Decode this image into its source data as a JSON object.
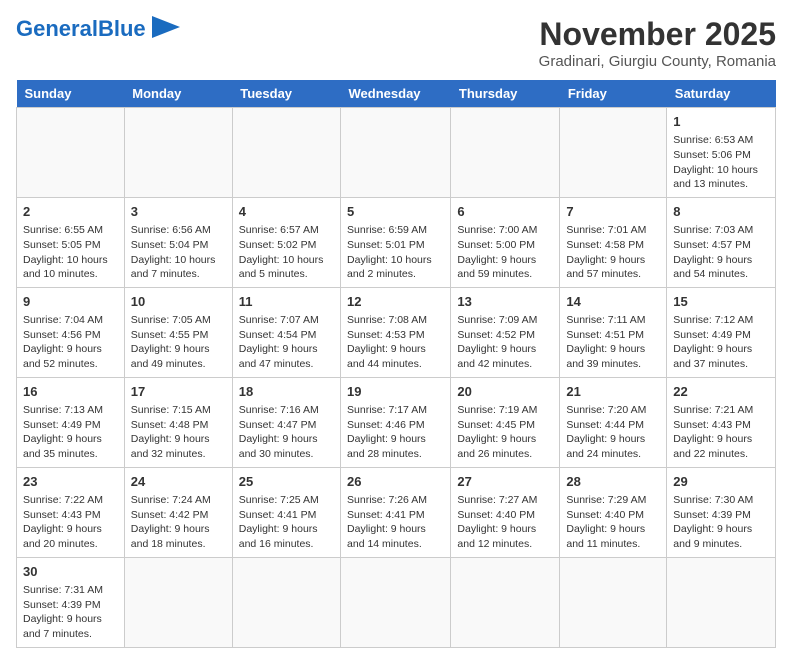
{
  "header": {
    "logo_general": "General",
    "logo_blue": "Blue",
    "month_title": "November 2025",
    "location": "Gradinari, Giurgiu County, Romania"
  },
  "weekdays": [
    "Sunday",
    "Monday",
    "Tuesday",
    "Wednesday",
    "Thursday",
    "Friday",
    "Saturday"
  ],
  "weeks": [
    [
      {
        "day": "",
        "info": ""
      },
      {
        "day": "",
        "info": ""
      },
      {
        "day": "",
        "info": ""
      },
      {
        "day": "",
        "info": ""
      },
      {
        "day": "",
        "info": ""
      },
      {
        "day": "",
        "info": ""
      },
      {
        "day": "1",
        "info": "Sunrise: 6:53 AM\nSunset: 5:06 PM\nDaylight: 10 hours\nand 13 minutes."
      }
    ],
    [
      {
        "day": "2",
        "info": "Sunrise: 6:55 AM\nSunset: 5:05 PM\nDaylight: 10 hours\nand 10 minutes."
      },
      {
        "day": "3",
        "info": "Sunrise: 6:56 AM\nSunset: 5:04 PM\nDaylight: 10 hours\nand 7 minutes."
      },
      {
        "day": "4",
        "info": "Sunrise: 6:57 AM\nSunset: 5:02 PM\nDaylight: 10 hours\nand 5 minutes."
      },
      {
        "day": "5",
        "info": "Sunrise: 6:59 AM\nSunset: 5:01 PM\nDaylight: 10 hours\nand 2 minutes."
      },
      {
        "day": "6",
        "info": "Sunrise: 7:00 AM\nSunset: 5:00 PM\nDaylight: 9 hours\nand 59 minutes."
      },
      {
        "day": "7",
        "info": "Sunrise: 7:01 AM\nSunset: 4:58 PM\nDaylight: 9 hours\nand 57 minutes."
      },
      {
        "day": "8",
        "info": "Sunrise: 7:03 AM\nSunset: 4:57 PM\nDaylight: 9 hours\nand 54 minutes."
      }
    ],
    [
      {
        "day": "9",
        "info": "Sunrise: 7:04 AM\nSunset: 4:56 PM\nDaylight: 9 hours\nand 52 minutes."
      },
      {
        "day": "10",
        "info": "Sunrise: 7:05 AM\nSunset: 4:55 PM\nDaylight: 9 hours\nand 49 minutes."
      },
      {
        "day": "11",
        "info": "Sunrise: 7:07 AM\nSunset: 4:54 PM\nDaylight: 9 hours\nand 47 minutes."
      },
      {
        "day": "12",
        "info": "Sunrise: 7:08 AM\nSunset: 4:53 PM\nDaylight: 9 hours\nand 44 minutes."
      },
      {
        "day": "13",
        "info": "Sunrise: 7:09 AM\nSunset: 4:52 PM\nDaylight: 9 hours\nand 42 minutes."
      },
      {
        "day": "14",
        "info": "Sunrise: 7:11 AM\nSunset: 4:51 PM\nDaylight: 9 hours\nand 39 minutes."
      },
      {
        "day": "15",
        "info": "Sunrise: 7:12 AM\nSunset: 4:49 PM\nDaylight: 9 hours\nand 37 minutes."
      }
    ],
    [
      {
        "day": "16",
        "info": "Sunrise: 7:13 AM\nSunset: 4:49 PM\nDaylight: 9 hours\nand 35 minutes."
      },
      {
        "day": "17",
        "info": "Sunrise: 7:15 AM\nSunset: 4:48 PM\nDaylight: 9 hours\nand 32 minutes."
      },
      {
        "day": "18",
        "info": "Sunrise: 7:16 AM\nSunset: 4:47 PM\nDaylight: 9 hours\nand 30 minutes."
      },
      {
        "day": "19",
        "info": "Sunrise: 7:17 AM\nSunset: 4:46 PM\nDaylight: 9 hours\nand 28 minutes."
      },
      {
        "day": "20",
        "info": "Sunrise: 7:19 AM\nSunset: 4:45 PM\nDaylight: 9 hours\nand 26 minutes."
      },
      {
        "day": "21",
        "info": "Sunrise: 7:20 AM\nSunset: 4:44 PM\nDaylight: 9 hours\nand 24 minutes."
      },
      {
        "day": "22",
        "info": "Sunrise: 7:21 AM\nSunset: 4:43 PM\nDaylight: 9 hours\nand 22 minutes."
      }
    ],
    [
      {
        "day": "23",
        "info": "Sunrise: 7:22 AM\nSunset: 4:43 PM\nDaylight: 9 hours\nand 20 minutes."
      },
      {
        "day": "24",
        "info": "Sunrise: 7:24 AM\nSunset: 4:42 PM\nDaylight: 9 hours\nand 18 minutes."
      },
      {
        "day": "25",
        "info": "Sunrise: 7:25 AM\nSunset: 4:41 PM\nDaylight: 9 hours\nand 16 minutes."
      },
      {
        "day": "26",
        "info": "Sunrise: 7:26 AM\nSunset: 4:41 PM\nDaylight: 9 hours\nand 14 minutes."
      },
      {
        "day": "27",
        "info": "Sunrise: 7:27 AM\nSunset: 4:40 PM\nDaylight: 9 hours\nand 12 minutes."
      },
      {
        "day": "28",
        "info": "Sunrise: 7:29 AM\nSunset: 4:40 PM\nDaylight: 9 hours\nand 11 minutes."
      },
      {
        "day": "29",
        "info": "Sunrise: 7:30 AM\nSunset: 4:39 PM\nDaylight: 9 hours\nand 9 minutes."
      }
    ],
    [
      {
        "day": "30",
        "info": "Sunrise: 7:31 AM\nSunset: 4:39 PM\nDaylight: 9 hours\nand 7 minutes."
      },
      {
        "day": "",
        "info": ""
      },
      {
        "day": "",
        "info": ""
      },
      {
        "day": "",
        "info": ""
      },
      {
        "day": "",
        "info": ""
      },
      {
        "day": "",
        "info": ""
      },
      {
        "day": "",
        "info": ""
      }
    ]
  ]
}
